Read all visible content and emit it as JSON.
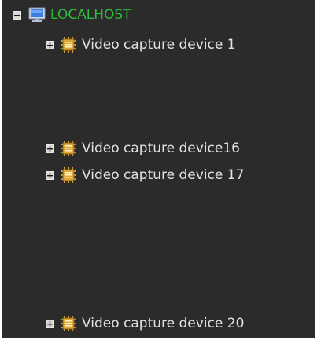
{
  "tree": {
    "root": {
      "label": "LOCALHOST",
      "expander": "minus",
      "icon": "computer-icon",
      "color": "#2fbc3a"
    },
    "devices": [
      {
        "label": "Video capture device 1",
        "expander": "plus",
        "icon": "chip-icon"
      },
      {
        "label": "Video capture device16",
        "expander": "plus",
        "icon": "chip-icon"
      },
      {
        "label": "Video capture device 17",
        "expander": "plus",
        "icon": "chip-icon"
      },
      {
        "label": "Video capture device 20",
        "expander": "plus",
        "icon": "chip-icon"
      }
    ]
  },
  "colors": {
    "background": "#2b2b2b",
    "text": "#e2e2e2",
    "root_text": "#2fbc3a"
  }
}
